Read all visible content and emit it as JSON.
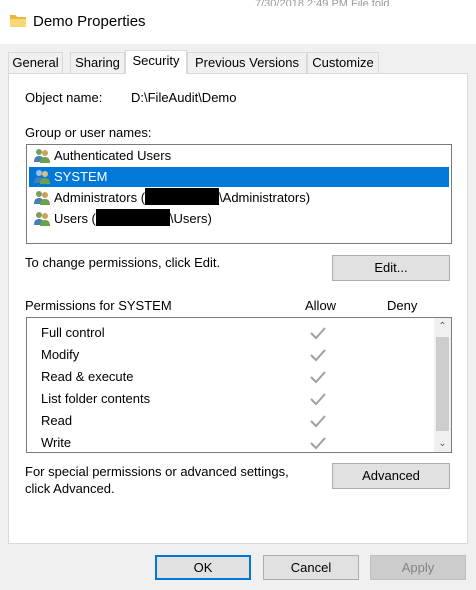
{
  "window": {
    "title": "Demo Properties",
    "background_strip": "7/30/2018 2:49 PM      File fold"
  },
  "tabs": [
    {
      "label": "General"
    },
    {
      "label": "Sharing"
    },
    {
      "label": "Security",
      "active": true
    },
    {
      "label": "Previous Versions"
    },
    {
      "label": "Customize"
    }
  ],
  "security": {
    "object_name_label": "Object name:",
    "object_name_value": "D:\\FileAudit\\Demo",
    "group_label": "Group or user names:",
    "users": [
      {
        "name": "Authenticated Users",
        "prefix": "",
        "suffix": ""
      },
      {
        "name": "SYSTEM",
        "prefix": "",
        "suffix": "",
        "selected": true
      },
      {
        "name": "",
        "prefix": "Administrators (",
        "suffix": "\\Administrators)"
      },
      {
        "name": "",
        "prefix": "Users (",
        "suffix": "\\Users)"
      }
    ],
    "change_text": "To change permissions, click Edit.",
    "edit_button": "Edit...",
    "permissions_for": "Permissions for SYSTEM",
    "allow_header": "Allow",
    "deny_header": "Deny",
    "permissions": [
      {
        "name": "Full control",
        "allow": true,
        "deny": false
      },
      {
        "name": "Modify",
        "allow": true,
        "deny": false
      },
      {
        "name": "Read & execute",
        "allow": true,
        "deny": false
      },
      {
        "name": "List folder contents",
        "allow": true,
        "deny": false
      },
      {
        "name": "Read",
        "allow": true,
        "deny": false
      },
      {
        "name": "Write",
        "allow": true,
        "deny": false
      }
    ],
    "special_text_line1": "For special permissions or advanced settings,",
    "special_text_line2": "click Advanced.",
    "advanced_button": "Advanced"
  },
  "footer": {
    "ok": "OK",
    "cancel": "Cancel",
    "apply": "Apply"
  },
  "colors": {
    "selection": "#0078d7",
    "check": "#a0a0a0"
  },
  "icons": {
    "window": "folder-icon",
    "user": "users-group-icon",
    "check": "checkmark-icon"
  }
}
